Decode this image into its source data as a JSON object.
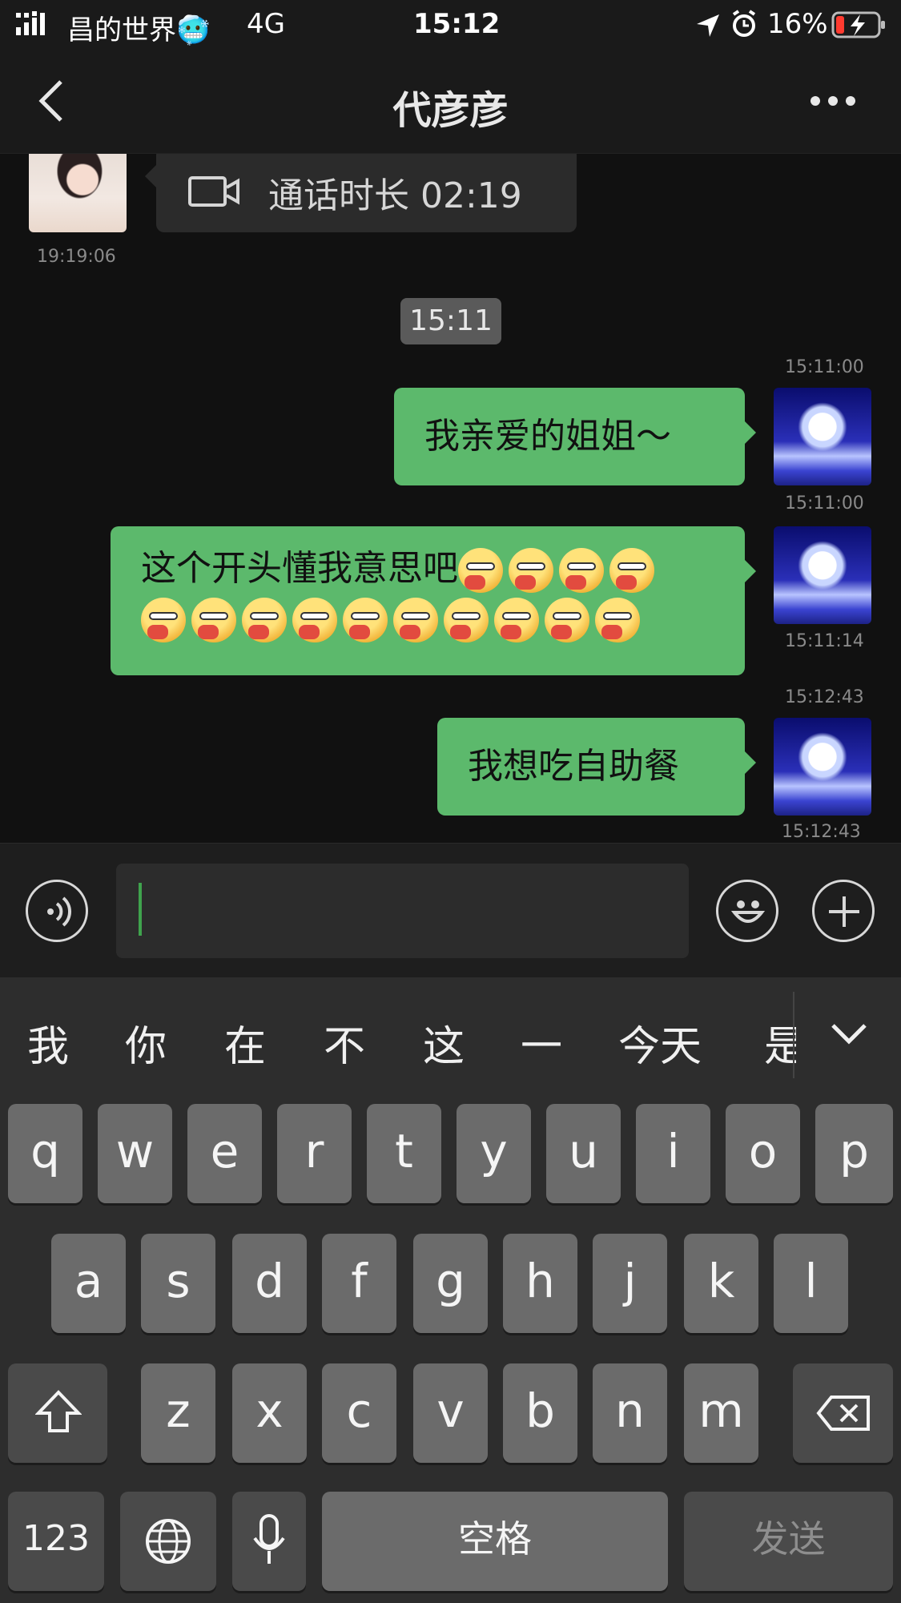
{
  "status_bar": {
    "carrier": "昌的世界🥶",
    "network": "4G",
    "time": "15:12",
    "battery": "16%"
  },
  "nav": {
    "back_icon": "chevron-left-icon",
    "title": "代彦彦",
    "more_icon": "more-dots-icon"
  },
  "chat": {
    "call_message": {
      "icon": "video-camera-icon",
      "text": "通话时长 02:19",
      "time": "19:19:06"
    },
    "time_divider": "15:11",
    "messages": [
      {
        "time_top": "15:11:00",
        "text": "我亲爱的姐姐～",
        "time_bottom": "15:11:00"
      },
      {
        "text": "这个开头懂我意思吧",
        "emoji_count": 14,
        "time_bottom": "15:11:14"
      },
      {
        "time_top": "15:12:43",
        "text": "我想吃自助餐",
        "time_bottom": "15:12:43"
      }
    ]
  },
  "input_bar": {
    "voice_icon": "voice-input-icon",
    "emoji_icon": "smiley-icon",
    "plus_icon": "plus-icon"
  },
  "keyboard": {
    "candidates": [
      "我",
      "你",
      "在",
      "不",
      "这",
      "一",
      "今天",
      "是"
    ],
    "row1": [
      "q",
      "w",
      "e",
      "r",
      "t",
      "y",
      "u",
      "i",
      "o",
      "p"
    ],
    "row2": [
      "a",
      "s",
      "d",
      "f",
      "g",
      "h",
      "j",
      "k",
      "l"
    ],
    "row3": [
      "z",
      "x",
      "c",
      "v",
      "b",
      "n",
      "m"
    ],
    "numbers_key": "123",
    "space_key": "空格",
    "send_key": "发送"
  }
}
